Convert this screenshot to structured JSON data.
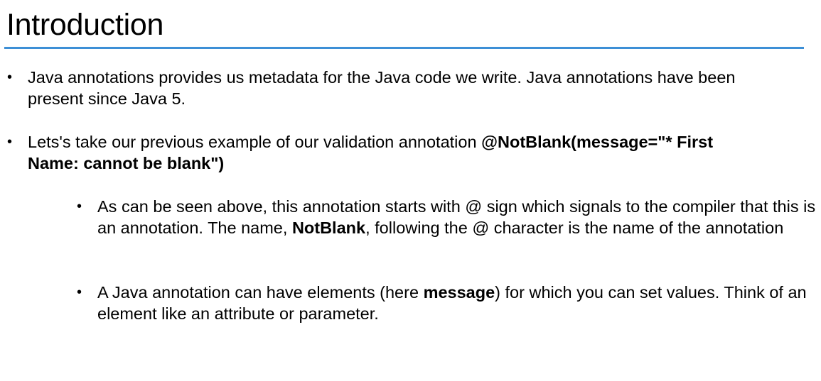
{
  "slide": {
    "title": "Introduction",
    "accent_color": "#3d8fd6",
    "bullet_glyph": "•",
    "bullets": [
      {
        "text": "Java annotations provides us metadata for the Java code we write. Java annotations have been present since Java 5."
      },
      {
        "text_before": "Lets's take our previous example of our validation annotation ",
        "bold": "@NotBlank(message=\"* First Name: cannot be blank\")"
      }
    ],
    "sub_bullets": [
      {
        "text_before": "As can be seen above, this annotation starts with @ sign which signals to the compiler that this is an annotation. The name, ",
        "bold": "NotBlank",
        "text_after": ", following the @ character is the name of the annotation"
      },
      {
        "text_before": "A Java annotation can have elements (here ",
        "bold": "message",
        "text_after": ") for which you can set values. Think of an element like an attribute or parameter."
      }
    ]
  }
}
